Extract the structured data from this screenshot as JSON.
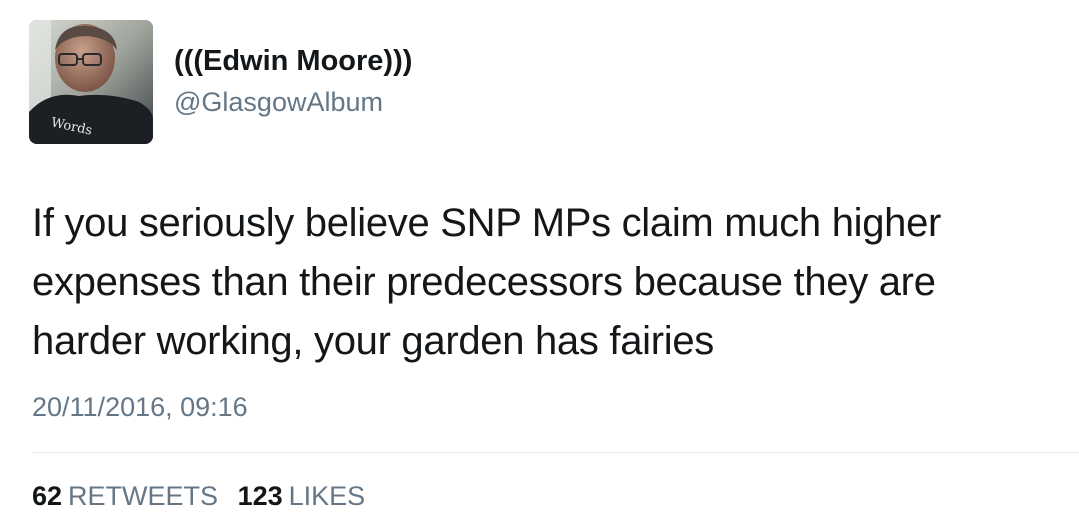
{
  "author": {
    "display_name": "(((Edwin Moore)))",
    "handle": "@GlasgowAlbum",
    "avatar_shirt_text": "Words"
  },
  "tweet": {
    "text_lines": [
      "If you seriously believe SNP MPs claim much higher",
      "expenses than their predecessors because they are",
      "harder working, your garden has fairies"
    ],
    "timestamp": "20/11/2016, 09:16"
  },
  "stats": {
    "retweets_count": "62",
    "retweets_label": "RETWEETS",
    "likes_count": "123",
    "likes_label": "LIKES"
  },
  "colors": {
    "text": "#14171a",
    "secondary": "#657786",
    "divider": "#e1e8ed"
  }
}
